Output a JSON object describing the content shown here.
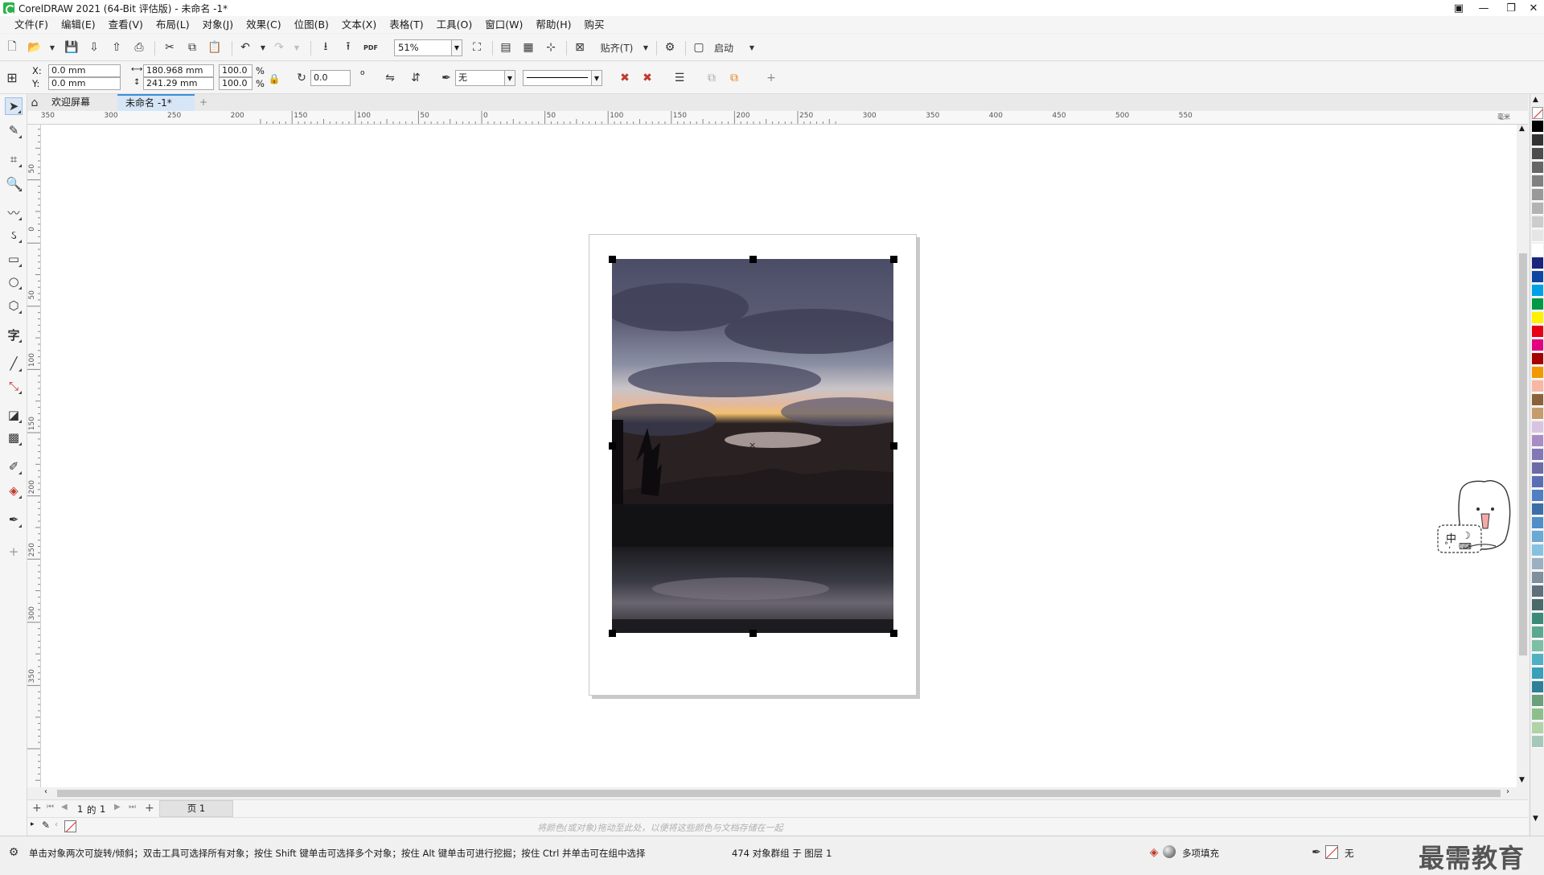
{
  "window": {
    "title": "CorelDRAW 2021 (64-Bit 评估版) - 未命名 -1*",
    "controls": [
      "minimize",
      "restore",
      "close"
    ]
  },
  "menu": [
    "文件(F)",
    "编辑(E)",
    "查看(V)",
    "布局(L)",
    "对象(J)",
    "效果(C)",
    "位图(B)",
    "文本(X)",
    "表格(T)",
    "工具(O)",
    "窗口(W)",
    "帮助(H)",
    "购买"
  ],
  "toolbar": {
    "zoom_value": "51%",
    "snap_label": "贴齐(T)",
    "launch_label": "启动",
    "pdf_label": "PDF"
  },
  "properties": {
    "x_label": "X:",
    "y_label": "Y:",
    "x_value": "0.0 mm",
    "y_value": "0.0 mm",
    "width_value": "180.968 mm",
    "height_value": "241.29 mm",
    "scale_w": "100.0",
    "scale_h": "100.0",
    "percent": "%",
    "rotation": "0.0",
    "degree": "o",
    "outline_fill": "无"
  },
  "tabs": {
    "welcome": "欢迎屏幕",
    "document": "未命名 -1*"
  },
  "ruler_h": [
    "350",
    "300",
    "250",
    "200",
    "150",
    "100",
    "50",
    "0",
    "50",
    "100",
    "150",
    "200",
    "250",
    "300",
    "350",
    "400",
    "450",
    "500",
    "550"
  ],
  "ruler_unit": "毫米",
  "ruler_v": [
    "50",
    "0",
    "50",
    "100",
    "150",
    "200",
    "250",
    "300",
    "350"
  ],
  "page_nav": {
    "current": "1",
    "of_label": "的",
    "total": "1",
    "page_tab": "页 1"
  },
  "color_hint": "将颜色(或对象)拖动至此处，以便将这些颜色与文档存储在一起",
  "status": {
    "hint": "单击对象两次可旋转/倾斜；双击工具可选择所有对象；按住 Shift 键单击可选择多个对象；按住 Alt 键单击可进行挖掘；按住 Ctrl 并单击可在组中选择",
    "selection": "474 对象群组 于 图层 1",
    "fill_label": "多项填充",
    "outline_label": "无"
  },
  "overlay": {
    "ime_label": "中",
    "watermark": "最需教育"
  },
  "palette_colors": [
    "#ffffff",
    "#000000",
    "#333333",
    "#4d4d4d",
    "#666666",
    "#808080",
    "#999999",
    "#b3b3b3",
    "#cccccc",
    "#e6e6e6",
    "#ffffff",
    "#1a237e",
    "#0d47a1",
    "#00a0e9",
    "#009944",
    "#fff100",
    "#e60012",
    "#e4007f",
    "#a40000",
    "#f39800",
    "#f7b7a3",
    "#8c6239",
    "#c69c6d",
    "#d7c4e0",
    "#a98cc4",
    "#8378b5",
    "#6b6ba8",
    "#5a6fb3",
    "#4f7fc2",
    "#3c6fa8",
    "#4e8fc8",
    "#6aa9d6",
    "#86c2e0",
    "#9bb0c0",
    "#7f8f9c",
    "#5f6f7c",
    "#4a6a6a",
    "#3b8a7a",
    "#5aa88f",
    "#7cbfa5",
    "#4fb0c4",
    "#3a9fb8",
    "#2f7f99",
    "#6aa07a",
    "#8cbf8c",
    "#b0d4a8",
    "#a6c8b8"
  ]
}
